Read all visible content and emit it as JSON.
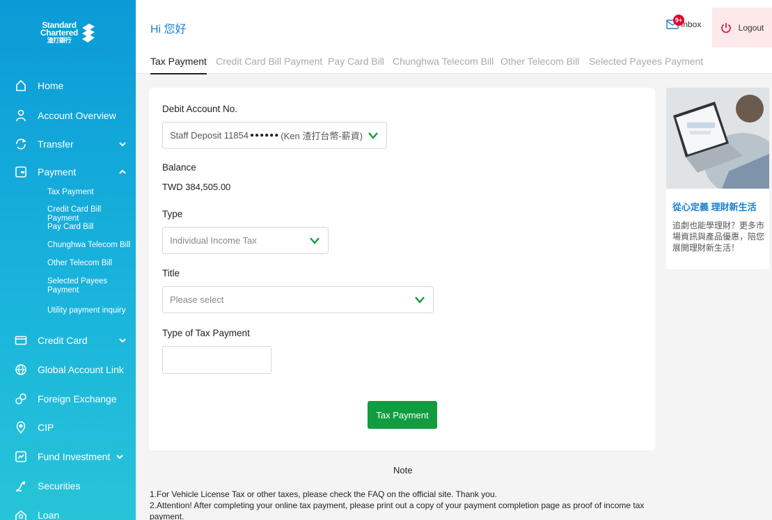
{
  "brand": {
    "line1": "Standard",
    "line2": "Chartered",
    "line3": "渣打銀行"
  },
  "sidebar": {
    "items": [
      {
        "label": "Home",
        "icon": "home-icon"
      },
      {
        "label": "Account Overview",
        "icon": "person-icon"
      },
      {
        "label": "Transfer",
        "icon": "transfer-icon"
      },
      {
        "label": "Payment",
        "icon": "payment-icon"
      },
      {
        "label": "Credit Card",
        "icon": "credit-card-icon"
      },
      {
        "label": "Global Account Link",
        "icon": "globe-icon"
      },
      {
        "label": "Foreign Exchange",
        "icon": "exchange-icon"
      },
      {
        "label": "CIP",
        "icon": "cip-icon"
      },
      {
        "label": "Fund Investment",
        "icon": "fund-icon"
      },
      {
        "label": "Securities",
        "icon": "securities-icon"
      },
      {
        "label": "Loan",
        "icon": "loan-icon"
      }
    ],
    "payment_sub": [
      "Tax Payment",
      "Credit Card Bill Payment",
      "Pay Card Bill",
      "Chunghwa Telecom Bill",
      "Other Telecom Bill",
      "Selected Payees Payment",
      "Utility payment inquiry"
    ]
  },
  "header": {
    "greeting": "Hi 您好",
    "inbox_label": "Inbox",
    "inbox_badge": "9+",
    "logout_label": "Logout"
  },
  "tabs": [
    "Tax Payment",
    "Credit Card Bill Payment",
    "Pay Card Bill",
    "Chunghwa Telecom Bill",
    "Other Telecom Bill",
    "Selected Payees Payment"
  ],
  "form": {
    "debit_label": "Debit Account No.",
    "debit_prefix": "Staff Deposit 11854",
    "debit_mask": "●●●●●●",
    "debit_suffix": "(Ken 渣打台幣-薪資)",
    "balance_label": "Balance",
    "balance_value": "TWD 384,505.00",
    "type_label": "Type",
    "type_value": "Individual Income Tax",
    "title_label": "Title",
    "title_placeholder": "Please select",
    "tax_type_label": "Type of Tax Payment",
    "submit_label": "Tax Payment"
  },
  "promo": {
    "title": "從心定義 理財新生活",
    "text": "追劇也能學理財？更多市場資訊與產品優惠，陪您展開理財新生活！"
  },
  "note": {
    "title": "Note",
    "line1": "1.For Vehicle License Tax or other taxes, please check the FAQ on the official site. Thank you.",
    "line2": "2.Attention! After completing your online tax payment, please print out a copy of your payment completion page as proof of income tax payment."
  },
  "colors": {
    "accent_blue": "#1a7fce",
    "primary_green": "#109d3f",
    "sidebar_top": "#0b9ad6",
    "sidebar_bottom": "#27c4d8",
    "logout_bg": "#fde8ea"
  }
}
